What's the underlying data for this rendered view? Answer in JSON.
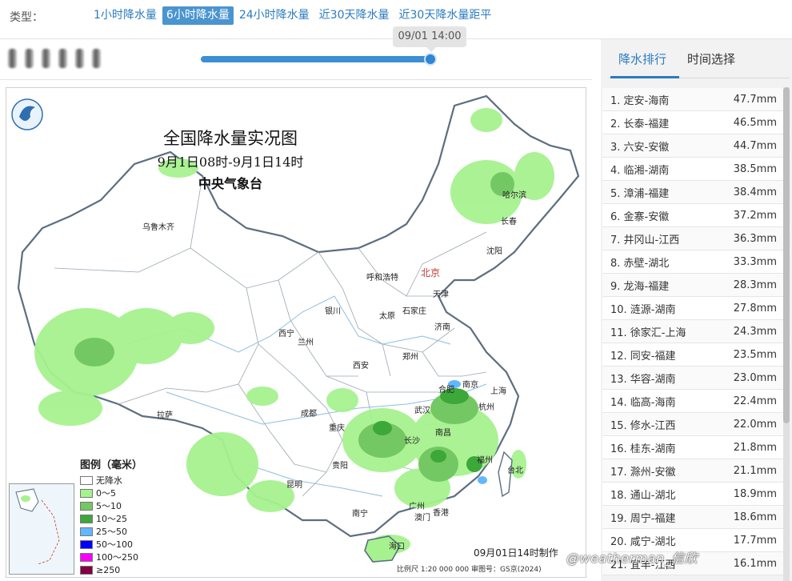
{
  "typebar": {
    "label": "类型：",
    "tabs": [
      {
        "label": "1小时降水量",
        "active": false
      },
      {
        "label": "6小时降水量",
        "active": true
      },
      {
        "label": "24小时降水量",
        "active": false
      },
      {
        "label": "近30天降水量",
        "active": false
      },
      {
        "label": "近30天降水量距平",
        "active": false
      }
    ]
  },
  "timebar": {
    "tooltip": "09/01 14:00",
    "progress": 1.0
  },
  "map": {
    "title": "全国降水量实况图",
    "subtitle": "9月1日08时-9月1日14时",
    "agency": "中央气象台",
    "footer": "09月01日14时制作",
    "scale_note": "比例尺 1:20 000 000      审图号：GS京(2024)",
    "legend": {
      "title": "图例（毫米）",
      "items": [
        {
          "label": "无降水",
          "color": "#ffffff"
        },
        {
          "label": "0～5",
          "color": "#a6f28f"
        },
        {
          "label": "5～10",
          "color": "#74c864"
        },
        {
          "label": "10～25",
          "color": "#3da83a"
        },
        {
          "label": "25～50",
          "color": "#61b8ff"
        },
        {
          "label": "50～100",
          "color": "#0000ff"
        },
        {
          "label": "100～250",
          "color": "#fa00fa"
        },
        {
          "label": "≥250",
          "color": "#800040"
        }
      ]
    },
    "cities": [
      {
        "name": "乌鲁木齐",
        "capital": false
      },
      {
        "name": "哈尔滨",
        "capital": false
      },
      {
        "name": "长春",
        "capital": false
      },
      {
        "name": "沈阳",
        "capital": false
      },
      {
        "name": "呼和浩特",
        "capital": false
      },
      {
        "name": "北京",
        "capital": true
      },
      {
        "name": "天津",
        "capital": false
      },
      {
        "name": "银川",
        "capital": false
      },
      {
        "name": "太原",
        "capital": false
      },
      {
        "name": "石家庄",
        "capital": false
      },
      {
        "name": "济南",
        "capital": false
      },
      {
        "name": "西宁",
        "capital": false
      },
      {
        "name": "兰州",
        "capital": false
      },
      {
        "name": "郑州",
        "capital": false
      },
      {
        "name": "西安",
        "capital": false
      },
      {
        "name": "合肥",
        "capital": false
      },
      {
        "name": "南京",
        "capital": false
      },
      {
        "name": "上海",
        "capital": false
      },
      {
        "name": "拉萨",
        "capital": false
      },
      {
        "name": "成都",
        "capital": false
      },
      {
        "name": "武汉",
        "capital": false
      },
      {
        "name": "杭州",
        "capital": false
      },
      {
        "name": "重庆",
        "capital": false
      },
      {
        "name": "长沙",
        "capital": false
      },
      {
        "name": "南昌",
        "capital": false
      },
      {
        "name": "福州",
        "capital": false
      },
      {
        "name": "贵阳",
        "capital": false
      },
      {
        "name": "台北",
        "capital": false
      },
      {
        "name": "昆明",
        "capital": false
      },
      {
        "name": "南宁",
        "capital": false
      },
      {
        "name": "广州",
        "capital": false
      },
      {
        "name": "香港",
        "capital": false
      },
      {
        "name": "澳门",
        "capital": false
      },
      {
        "name": "海口",
        "capital": false
      }
    ]
  },
  "ranking": {
    "tabs": [
      "降水排行",
      "时间选择"
    ],
    "active_tab": 0,
    "rows": [
      {
        "name": "1. 定安-海南",
        "value": "47.7mm"
      },
      {
        "name": "2. 长泰-福建",
        "value": "46.5mm"
      },
      {
        "name": "3. 六安-安徽",
        "value": "44.7mm"
      },
      {
        "name": "4. 临湘-湖南",
        "value": "38.5mm"
      },
      {
        "name": "5. 漳浦-福建",
        "value": "38.4mm"
      },
      {
        "name": "6. 金寨-安徽",
        "value": "37.2mm"
      },
      {
        "name": "7. 井冈山-江西",
        "value": "36.3mm"
      },
      {
        "name": "8. 赤壁-湖北",
        "value": "33.3mm"
      },
      {
        "name": "9. 龙海-福建",
        "value": "28.3mm"
      },
      {
        "name": "10. 涟源-湖南",
        "value": "27.8mm"
      },
      {
        "name": "11. 徐家汇-上海",
        "value": "24.3mm"
      },
      {
        "name": "12. 同安-福建",
        "value": "23.5mm"
      },
      {
        "name": "13. 华容-湖南",
        "value": "23.0mm"
      },
      {
        "name": "14. 临高-海南",
        "value": "22.4mm"
      },
      {
        "name": "15. 修水-江西",
        "value": "22.0mm"
      },
      {
        "name": "16. 桂东-湖南",
        "value": "21.8mm"
      },
      {
        "name": "17. 滁州-安徽",
        "value": "21.1mm"
      },
      {
        "name": "18. 通山-湖北",
        "value": "18.9mm"
      },
      {
        "name": "19. 周宁-福建",
        "value": "18.6mm"
      },
      {
        "name": "20. 咸宁-湖北",
        "value": "17.7mm"
      },
      {
        "name": "21. 宜丰-江西",
        "value": "16.1mm"
      }
    ]
  },
  "watermark": "@weatherman_信欣"
}
